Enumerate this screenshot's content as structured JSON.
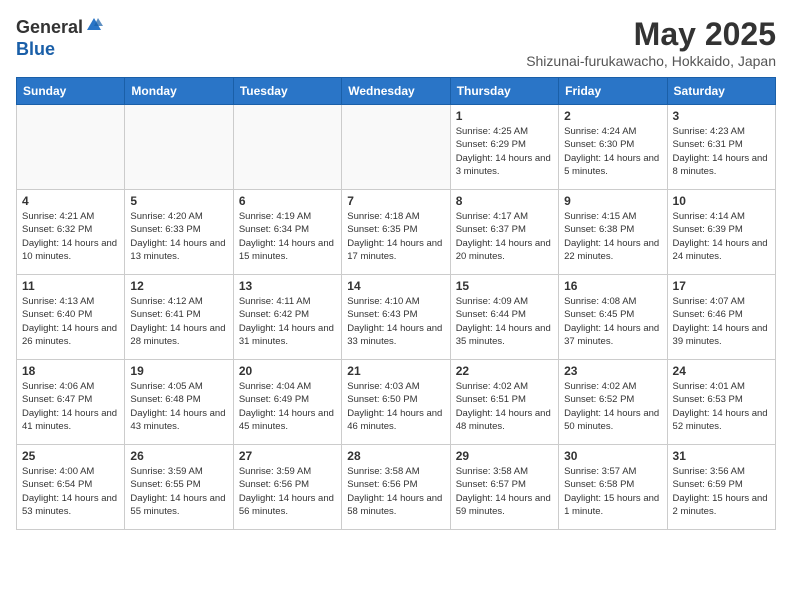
{
  "header": {
    "logo_general": "General",
    "logo_blue": "Blue",
    "month_title": "May 2025",
    "location": "Shizunai-furukawacho, Hokkaido, Japan"
  },
  "weekdays": [
    "Sunday",
    "Monday",
    "Tuesday",
    "Wednesday",
    "Thursday",
    "Friday",
    "Saturday"
  ],
  "weeks": [
    [
      {
        "day": "",
        "info": ""
      },
      {
        "day": "",
        "info": ""
      },
      {
        "day": "",
        "info": ""
      },
      {
        "day": "",
        "info": ""
      },
      {
        "day": "1",
        "info": "Sunrise: 4:25 AM\nSunset: 6:29 PM\nDaylight: 14 hours\nand 3 minutes."
      },
      {
        "day": "2",
        "info": "Sunrise: 4:24 AM\nSunset: 6:30 PM\nDaylight: 14 hours\nand 5 minutes."
      },
      {
        "day": "3",
        "info": "Sunrise: 4:23 AM\nSunset: 6:31 PM\nDaylight: 14 hours\nand 8 minutes."
      }
    ],
    [
      {
        "day": "4",
        "info": "Sunrise: 4:21 AM\nSunset: 6:32 PM\nDaylight: 14 hours\nand 10 minutes."
      },
      {
        "day": "5",
        "info": "Sunrise: 4:20 AM\nSunset: 6:33 PM\nDaylight: 14 hours\nand 13 minutes."
      },
      {
        "day": "6",
        "info": "Sunrise: 4:19 AM\nSunset: 6:34 PM\nDaylight: 14 hours\nand 15 minutes."
      },
      {
        "day": "7",
        "info": "Sunrise: 4:18 AM\nSunset: 6:35 PM\nDaylight: 14 hours\nand 17 minutes."
      },
      {
        "day": "8",
        "info": "Sunrise: 4:17 AM\nSunset: 6:37 PM\nDaylight: 14 hours\nand 20 minutes."
      },
      {
        "day": "9",
        "info": "Sunrise: 4:15 AM\nSunset: 6:38 PM\nDaylight: 14 hours\nand 22 minutes."
      },
      {
        "day": "10",
        "info": "Sunrise: 4:14 AM\nSunset: 6:39 PM\nDaylight: 14 hours\nand 24 minutes."
      }
    ],
    [
      {
        "day": "11",
        "info": "Sunrise: 4:13 AM\nSunset: 6:40 PM\nDaylight: 14 hours\nand 26 minutes."
      },
      {
        "day": "12",
        "info": "Sunrise: 4:12 AM\nSunset: 6:41 PM\nDaylight: 14 hours\nand 28 minutes."
      },
      {
        "day": "13",
        "info": "Sunrise: 4:11 AM\nSunset: 6:42 PM\nDaylight: 14 hours\nand 31 minutes."
      },
      {
        "day": "14",
        "info": "Sunrise: 4:10 AM\nSunset: 6:43 PM\nDaylight: 14 hours\nand 33 minutes."
      },
      {
        "day": "15",
        "info": "Sunrise: 4:09 AM\nSunset: 6:44 PM\nDaylight: 14 hours\nand 35 minutes."
      },
      {
        "day": "16",
        "info": "Sunrise: 4:08 AM\nSunset: 6:45 PM\nDaylight: 14 hours\nand 37 minutes."
      },
      {
        "day": "17",
        "info": "Sunrise: 4:07 AM\nSunset: 6:46 PM\nDaylight: 14 hours\nand 39 minutes."
      }
    ],
    [
      {
        "day": "18",
        "info": "Sunrise: 4:06 AM\nSunset: 6:47 PM\nDaylight: 14 hours\nand 41 minutes."
      },
      {
        "day": "19",
        "info": "Sunrise: 4:05 AM\nSunset: 6:48 PM\nDaylight: 14 hours\nand 43 minutes."
      },
      {
        "day": "20",
        "info": "Sunrise: 4:04 AM\nSunset: 6:49 PM\nDaylight: 14 hours\nand 45 minutes."
      },
      {
        "day": "21",
        "info": "Sunrise: 4:03 AM\nSunset: 6:50 PM\nDaylight: 14 hours\nand 46 minutes."
      },
      {
        "day": "22",
        "info": "Sunrise: 4:02 AM\nSunset: 6:51 PM\nDaylight: 14 hours\nand 48 minutes."
      },
      {
        "day": "23",
        "info": "Sunrise: 4:02 AM\nSunset: 6:52 PM\nDaylight: 14 hours\nand 50 minutes."
      },
      {
        "day": "24",
        "info": "Sunrise: 4:01 AM\nSunset: 6:53 PM\nDaylight: 14 hours\nand 52 minutes."
      }
    ],
    [
      {
        "day": "25",
        "info": "Sunrise: 4:00 AM\nSunset: 6:54 PM\nDaylight: 14 hours\nand 53 minutes."
      },
      {
        "day": "26",
        "info": "Sunrise: 3:59 AM\nSunset: 6:55 PM\nDaylight: 14 hours\nand 55 minutes."
      },
      {
        "day": "27",
        "info": "Sunrise: 3:59 AM\nSunset: 6:56 PM\nDaylight: 14 hours\nand 56 minutes."
      },
      {
        "day": "28",
        "info": "Sunrise: 3:58 AM\nSunset: 6:56 PM\nDaylight: 14 hours\nand 58 minutes."
      },
      {
        "day": "29",
        "info": "Sunrise: 3:58 AM\nSunset: 6:57 PM\nDaylight: 14 hours\nand 59 minutes."
      },
      {
        "day": "30",
        "info": "Sunrise: 3:57 AM\nSunset: 6:58 PM\nDaylight: 15 hours\nand 1 minute."
      },
      {
        "day": "31",
        "info": "Sunrise: 3:56 AM\nSunset: 6:59 PM\nDaylight: 15 hours\nand 2 minutes."
      }
    ]
  ]
}
